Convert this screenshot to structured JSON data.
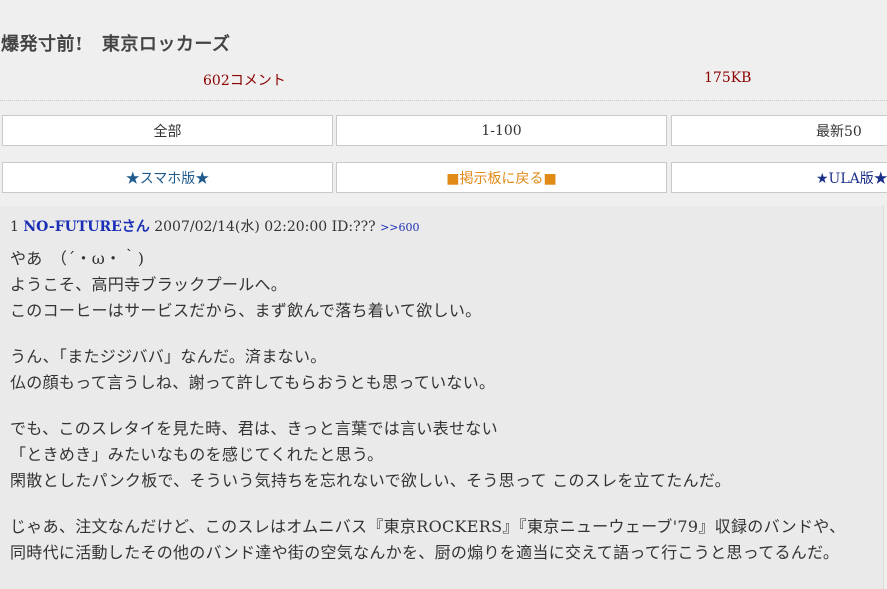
{
  "thread": {
    "title": "爆発寸前!　東京ロッカーズ",
    "comments": "602コメント",
    "size": "175KB"
  },
  "nav": {
    "all": "全部",
    "range": "1-100",
    "latest": "最新50",
    "smartphone": "★スマホ版★",
    "back": "■掲示板に戻る■",
    "ula": "★ULA版★"
  },
  "post": {
    "number": "1",
    "name": "NO-FUTUREさん",
    "date": "2007/02/14(水) 02:20:00 ID:???",
    "reply_ref": ">>600",
    "paragraphs": [
      [
        "やあ　（´・ω・｀)",
        "ようこそ、高円寺ブラックプールへ。",
        "このコーヒーはサービスだから、まず飲んで落ち着いて欲しい。"
      ],
      [
        "うん、「またジジババ」なんだ。済まない。",
        "仏の顔もって言うしね、謝って許してもらおうとも思っていない。"
      ],
      [
        "でも、このスレタイを見た時、君は、きっと言葉では言い表せない",
        "「ときめき」みたいなものを感じてくれたと思う。",
        "閑散としたパンク板で、そういう気持ちを忘れないで欲しい、そう思って このスレを立てたんだ。"
      ],
      [
        "じゃあ、注文なんだけど、このスレはオムニバス『東京ROCKERS』『東京ニューウェーブ'79』収録のバンドや、",
        "同時代に活動したその他のバンド達や街の空気なんかを、厨の煽りを適当に交えて語って行こうと思ってるんだ。"
      ]
    ]
  },
  "colors": {
    "meta": "#8b0000",
    "link": "#1a2fb5",
    "smartphone": "#1e5a8c",
    "back": "#e08a18",
    "ula": "#1a2f8a"
  }
}
